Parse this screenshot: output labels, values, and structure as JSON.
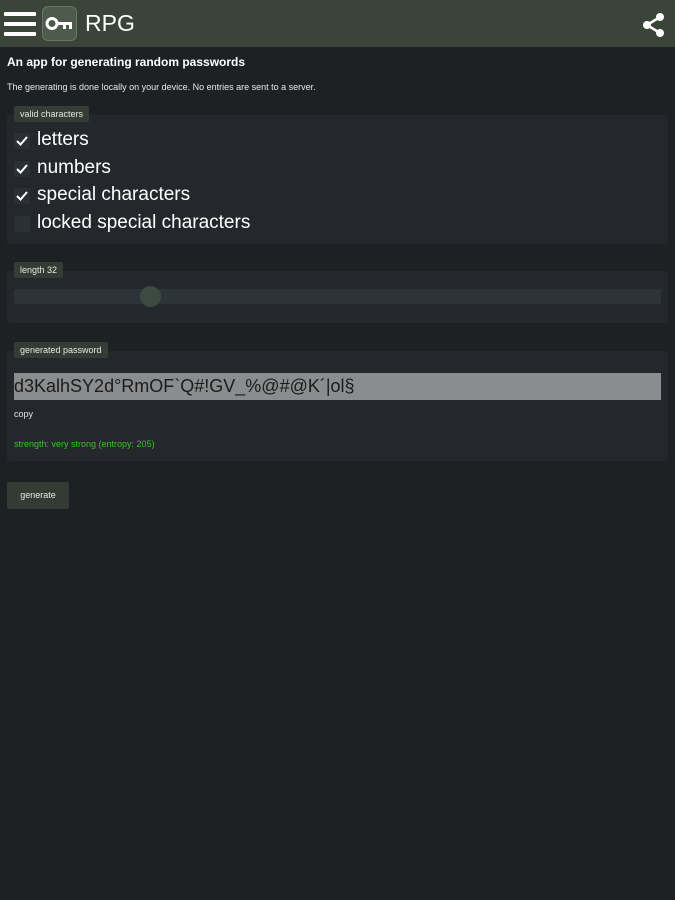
{
  "app": {
    "title": "RPG",
    "icon": "key-icon"
  },
  "intro": {
    "heading": "An app for generating random passwords",
    "subtext": "The generating is done locally on your device. No entries are sent to a server."
  },
  "characters": {
    "legend": "valid characters",
    "options": [
      {
        "label": "letters",
        "checked": true
      },
      {
        "label": "numbers",
        "checked": true
      },
      {
        "label": "special characters",
        "checked": true
      },
      {
        "label": "locked special characters",
        "checked": false
      }
    ]
  },
  "length": {
    "legend": "length 32",
    "value": 32
  },
  "generated": {
    "legend": "generated password",
    "password": "d3KalhSY2d°RmOF`Q#!GV_%@#@K´|ol§",
    "copy_label": "copy",
    "strength": "strength: very strong (entropy: 205)"
  },
  "actions": {
    "generate_label": "generate"
  },
  "colors": {
    "topbar": "#3b4439",
    "background": "#1e2124",
    "card": "#24282c",
    "legend": "#343d33",
    "strength": "#3fbf2f"
  }
}
